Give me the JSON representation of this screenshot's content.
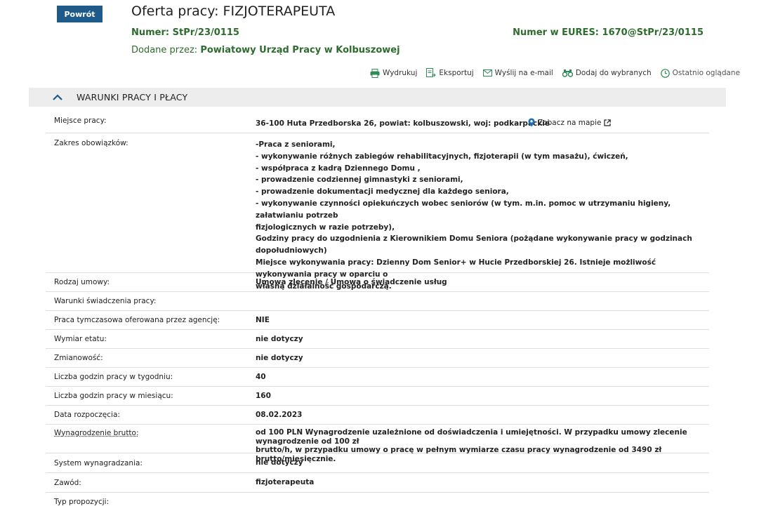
{
  "header": {
    "back_label": "Powrót",
    "title": "Oferta pracy: FIZJOTERAPEUTA",
    "number": "Numer: StPr/23/0115",
    "eures": "Numer w EURES: 1670@StPr/23/0115",
    "added_by_label": "Dodane przez: ",
    "added_by_value": "Powiatowy Urząd Pracy w Kolbuszowej"
  },
  "toolbar": {
    "print": "Wydrukuj",
    "export": "Eksportuj",
    "email": "Wyślij na e-mail",
    "favorites": "Dodaj do wybranych",
    "recent": "Ostatnio oglądane"
  },
  "section": {
    "title": "WARUNKI PRACY I PŁACY"
  },
  "map_link": "Zobacz na mapie",
  "colors": {
    "accent_green": "#2e6b2e",
    "button_blue": "#1f5b8a",
    "map_pin": "#1f6fb5"
  },
  "rows": [
    {
      "label": "Miejsce pracy:",
      "value": "36-100 Huta Przedborska 26, powiat: kolbuszowski, woj: podkarpackie"
    },
    {
      "label": "Zakres obowiązków:",
      "lines": [
        "-Praca z seniorami,",
        "- wykonywanie różnych zabiegów rehabilitacyjnych, fizjoterapii (w tym masażu), ćwiczeń,",
        "- współpraca z kadrą Dziennego Domu ,",
        "- prowadzenie codziennej gimnastyki z seniorami,",
        "- prowadzenie dokumentacji medycznej dla każdego seniora,",
        "- wykonywanie czynności opiekuńczych wobec seniorów (w tym. m.in. pomoc w utrzymaniu higieny, załatwianiu potrzeb",
        "fizjologicznych w razie potrzeby),",
        "Godziny pracy do uzgodnienia z Kierownikiem Domu Seniora (pożądane wykonywanie pracy w godzinach dopołudniowych)",
        "Miejsce wykonywania pracy: Dzienny Dom Senior+ w Hucie Przedborskiej 26. Istnieje możliwość wykonywania pracy w oparciu o",
        "własną działalność gospodarczą."
      ]
    },
    {
      "label": "Rodzaj umowy:",
      "value": "Umowa zlecenie / Umowa o świadczenie usług"
    },
    {
      "label": "Warunki świadczenia pracy:",
      "value": ""
    },
    {
      "label": "Praca tymczasowa oferowana przez agencję:",
      "value": "NIE"
    },
    {
      "label": "Wymiar etatu:",
      "value": "nie dotyczy"
    },
    {
      "label": "Zmianowość:",
      "value": "nie dotyczy"
    },
    {
      "label": "Liczba godzin pracy w tygodniu:",
      "value": "40"
    },
    {
      "label": "Liczba godzin pracy w miesiącu:",
      "value": "160"
    },
    {
      "label": "Data rozpoczęcia:",
      "value": "08.02.2023"
    },
    {
      "label": "Wynagrodzenie brutto:",
      "lines": [
        "od 100 PLN Wynagrodzenie uzależnione od doświadczenia i umiejętności. W przypadku umowy zlecenie wynagrodzenie od 100 zł",
        "brutto/h, w przypadku umowy o pracę w pełnym wymiarze czasu pracy wynagrodzenie od 3490 zł brutto/miesięcznie."
      ]
    },
    {
      "label": "System wynagradzania:",
      "value": "nie dotyczy"
    },
    {
      "label": "Zawód:",
      "value": "fizjoterapeuta"
    },
    {
      "label": "Typ propozycji:",
      "value": ""
    }
  ]
}
